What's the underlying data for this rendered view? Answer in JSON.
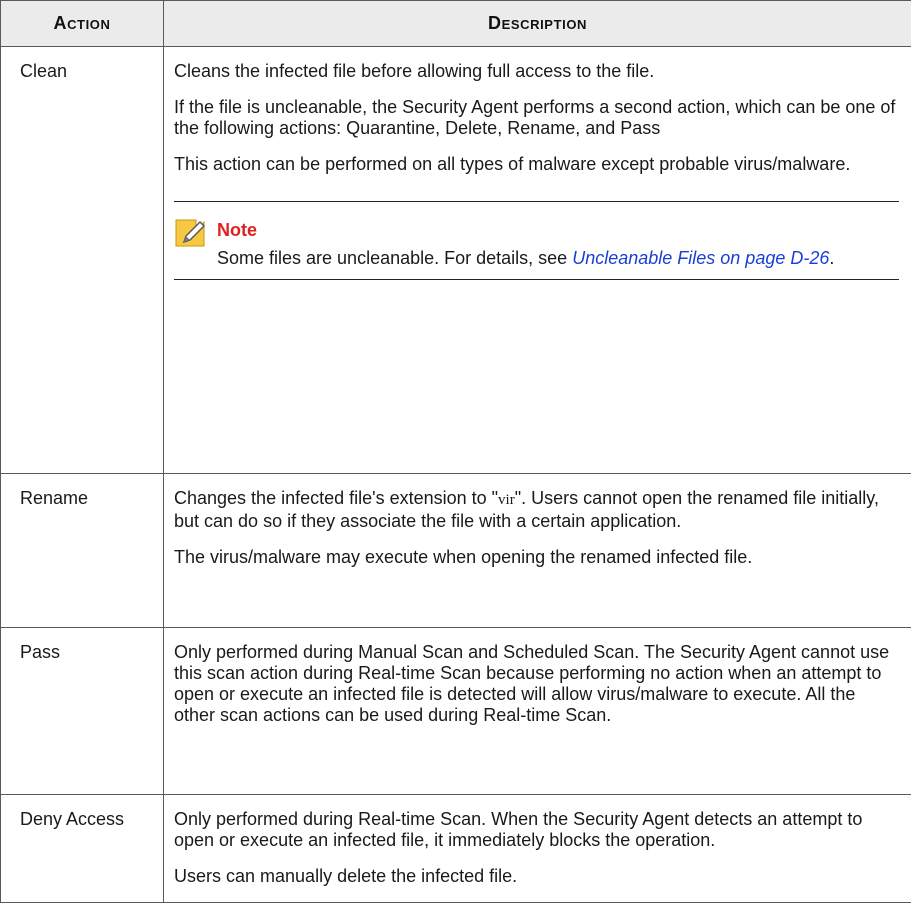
{
  "table": {
    "header": {
      "action": "Action",
      "description": "Description"
    },
    "rows": [
      {
        "action": "Clean",
        "paragraphs": [
          "Cleans the infected file before allowing full access to the file.",
          "If the file is uncleanable, the Security Agent performs a second action, which can be one of the following actions: Quarantine, Delete, Rename, and Pass",
          "This action can be performed on all types of malware except probable virus/malware."
        ],
        "note": {
          "title": "Note",
          "text": "Some files are uncleanable. For details, see ",
          "link": "Uncleanable Files on page D-26",
          "after": "."
        }
      },
      {
        "action": "Rename",
        "p1_before": "Changes the infected file's extension to \"",
        "p1_ext": "vir",
        "p1_after": "\". Users cannot open the renamed file initially, but can do so if they associate the file with a certain application.",
        "p2": "The virus/malware may execute when opening the renamed infected file."
      },
      {
        "action": "Pass",
        "paragraphs": [
          "Only performed during Manual Scan and Scheduled Scan. The Security Agent cannot use this scan action during Real-time Scan because performing no action when an attempt to open or execute an infected file is detected will allow virus/malware to execute. All the other scan actions can be used during Real-time Scan."
        ]
      },
      {
        "action": "Deny Access",
        "paragraphs": [
          "Only performed during Real-time Scan. When the Security Agent detects an attempt to open or execute an infected file, it immediately blocks the operation.",
          "Users can manually delete the infected file."
        ]
      }
    ]
  },
  "colors": {
    "note_title": "#e21e1e",
    "link": "#1b3fd6",
    "header_bg": "#ebebeb",
    "icon_fill": "#f7c843"
  },
  "icons": {
    "note": "note-pencil-icon"
  }
}
